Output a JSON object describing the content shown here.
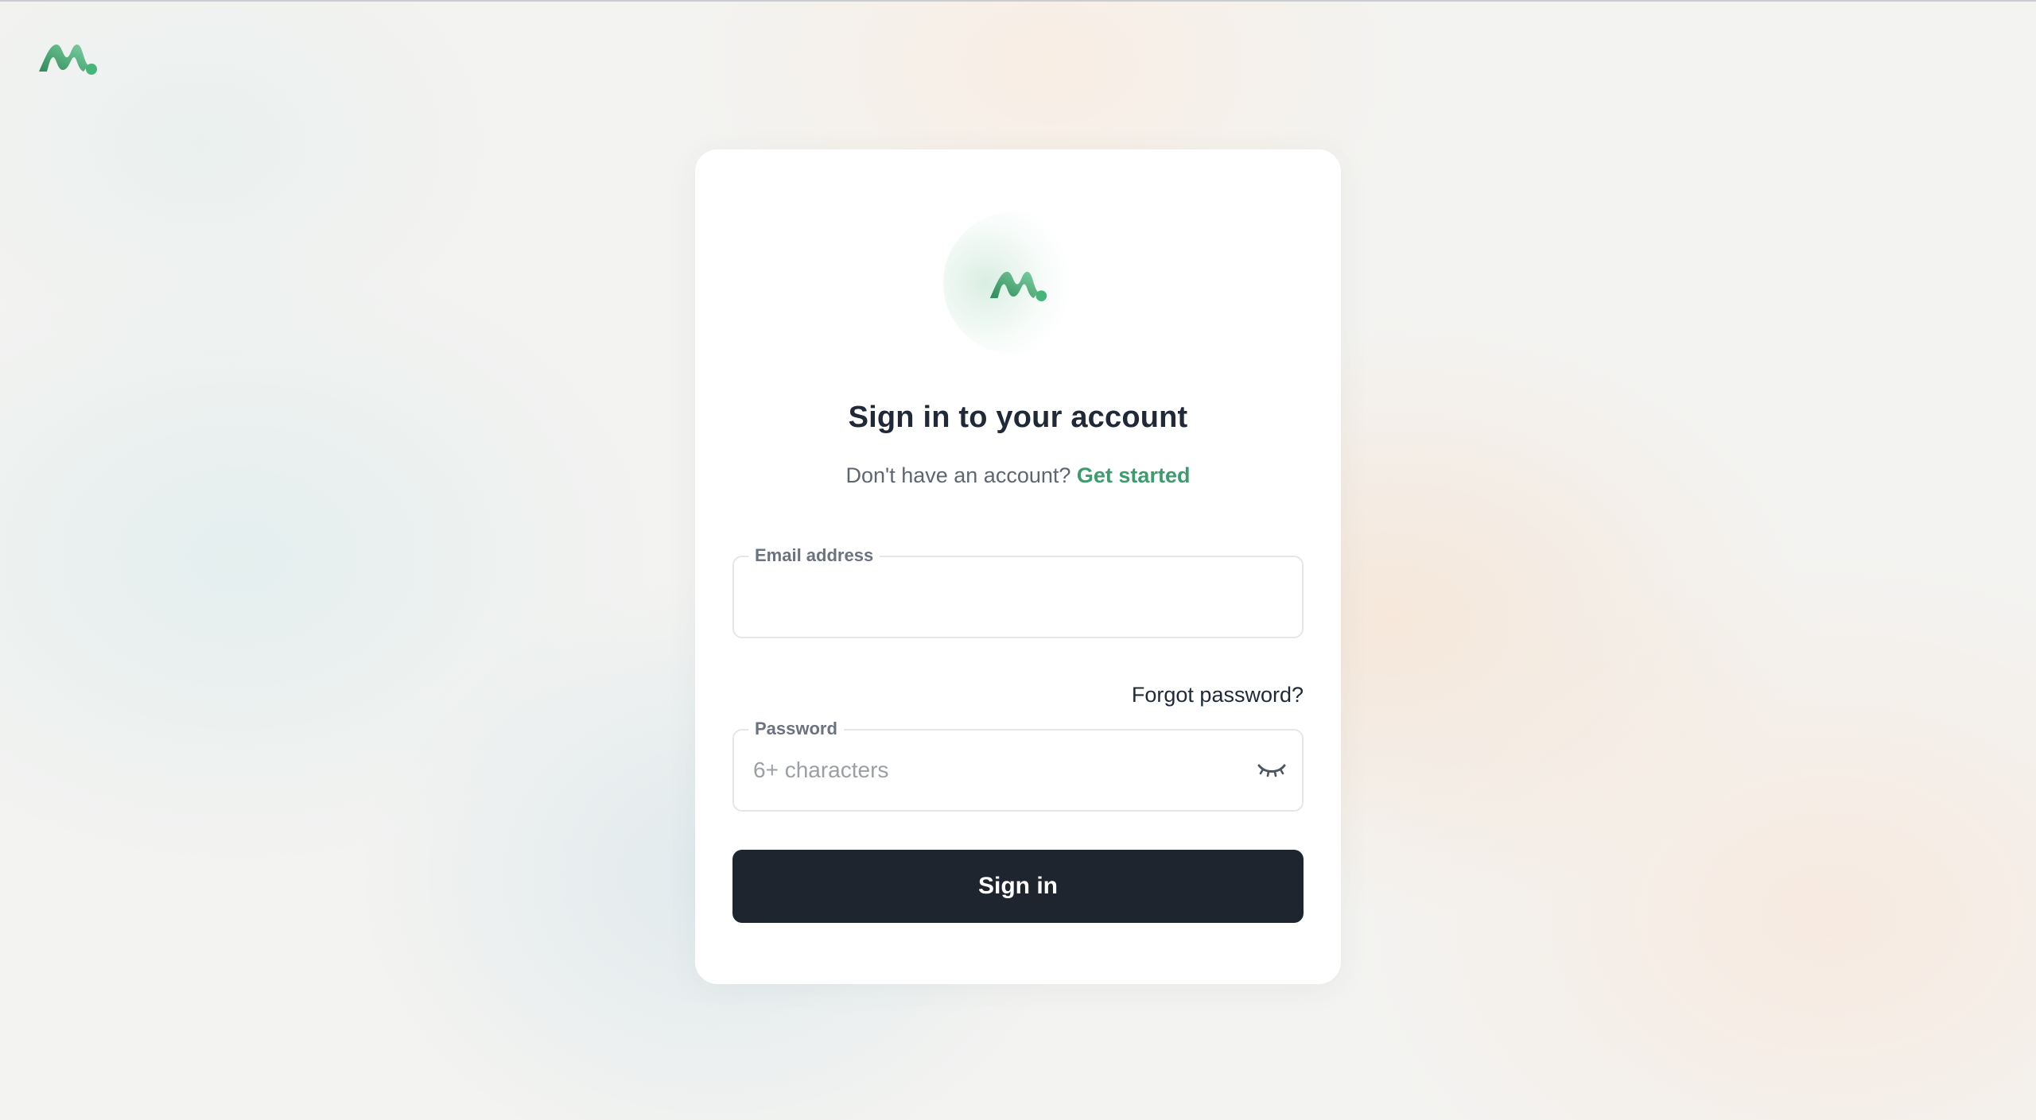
{
  "brand": {
    "logo_icon": "brand-m-logo-icon",
    "gradient_colors": [
      "#2f8a5b",
      "#7fd1a2"
    ],
    "dot_color": "#45b57a"
  },
  "card": {
    "title": "Sign in to your account",
    "subtitle_prefix": "Don't have an account?",
    "subtitle_link": "Get started"
  },
  "form": {
    "email": {
      "label": "Email address",
      "value": "",
      "placeholder": ""
    },
    "forgot_password": "Forgot password?",
    "password": {
      "label": "Password",
      "value": "",
      "placeholder": "6+ characters",
      "toggle_icon": "eye-closed-icon"
    },
    "submit_label": "Sign in"
  },
  "colors": {
    "accent": "#3f9a6e",
    "button_bg": "#1f252e",
    "text_primary": "#1f2937"
  }
}
